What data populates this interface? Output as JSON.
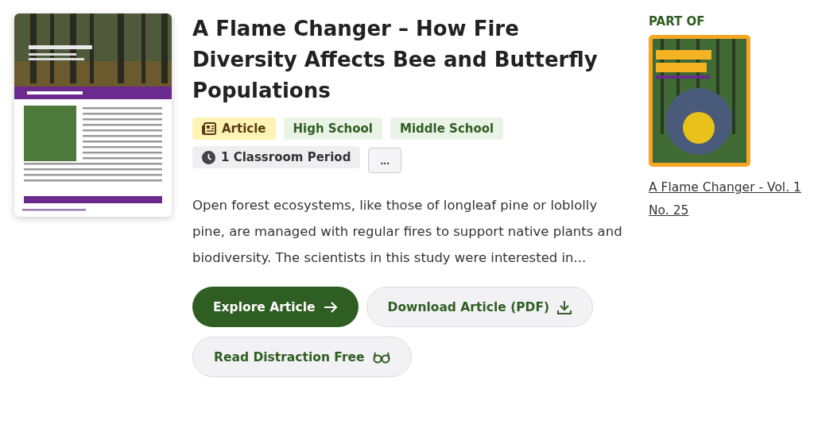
{
  "title": "A Flame Changer – How Fire Diversity Affects Bee and Butterfly Populations",
  "tags": [
    {
      "kind": "type",
      "label": "Article"
    },
    {
      "kind": "grade",
      "label": "High School"
    },
    {
      "kind": "grade",
      "label": "Middle School"
    },
    {
      "kind": "time",
      "label": "1 Classroom Period"
    },
    {
      "kind": "more",
      "label": "..."
    }
  ],
  "description": "Open forest ecosystems, like those of longleaf pine or loblolly pine, are managed with regular fires to support native plants and biodiversity. The scientists in this study were interested in...",
  "buttons": [
    {
      "kind": "primary",
      "label": "Explore Article"
    },
    {
      "kind": "download",
      "label": "Download Article (PDF)"
    },
    {
      "kind": "reader",
      "label": "Read Distraction Free"
    }
  ],
  "part_of": {
    "heading": "PART OF",
    "link": "A Flame Changer - Vol. 1 No. 25"
  }
}
